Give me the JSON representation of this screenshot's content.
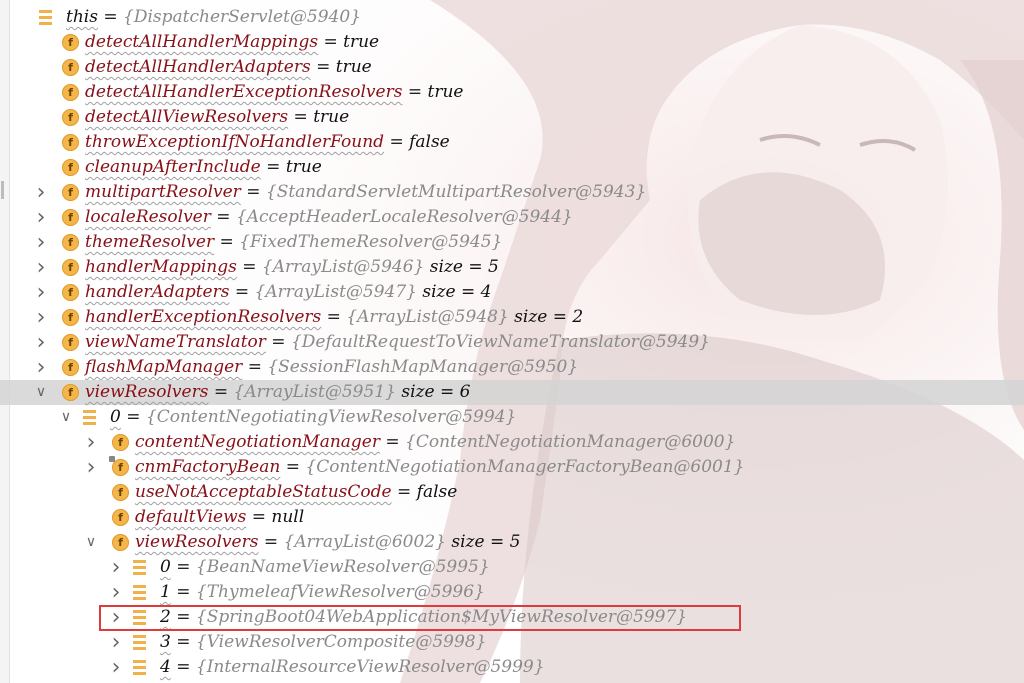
{
  "debugger": {
    "rows": [
      {
        "depth": 0,
        "icon": "list-icon",
        "chevron": "none",
        "name": "this",
        "eq": "=",
        "object": "{DispatcherServlet@5940}",
        "value": "",
        "size": "",
        "selected": false,
        "plain": true
      },
      {
        "depth": 1,
        "icon": "field-icon",
        "chevron": "none",
        "name": "detectAllHandlerMappings",
        "eq": "=",
        "object": "",
        "value": "true",
        "size": "",
        "selected": false
      },
      {
        "depth": 1,
        "icon": "field-icon",
        "chevron": "none",
        "name": "detectAllHandlerAdapters",
        "eq": "=",
        "object": "",
        "value": "true",
        "size": "",
        "selected": false
      },
      {
        "depth": 1,
        "icon": "field-icon",
        "chevron": "none",
        "name": "detectAllHandlerExceptionResolvers",
        "eq": "=",
        "object": "",
        "value": "true",
        "size": "",
        "selected": false
      },
      {
        "depth": 1,
        "icon": "field-icon",
        "chevron": "none",
        "name": "detectAllViewResolvers",
        "eq": "=",
        "object": "",
        "value": "true",
        "size": "",
        "selected": false
      },
      {
        "depth": 1,
        "icon": "field-icon",
        "chevron": "none",
        "name": "throwExceptionIfNoHandlerFound",
        "eq": "=",
        "object": "",
        "value": "false",
        "size": "",
        "selected": false
      },
      {
        "depth": 1,
        "icon": "field-icon",
        "chevron": "none",
        "name": "cleanupAfterInclude",
        "eq": "=",
        "object": "",
        "value": "true",
        "size": "",
        "selected": false
      },
      {
        "depth": 1,
        "icon": "field-icon",
        "chevron": "collapsed",
        "name": "multipartResolver",
        "eq": "=",
        "object": "{StandardServletMultipartResolver@5943}",
        "value": "",
        "size": "",
        "selected": false
      },
      {
        "depth": 1,
        "icon": "field-icon",
        "chevron": "collapsed",
        "name": "localeResolver",
        "eq": "=",
        "object": "{AcceptHeaderLocaleResolver@5944}",
        "value": "",
        "size": "",
        "selected": false
      },
      {
        "depth": 1,
        "icon": "field-icon",
        "chevron": "collapsed",
        "name": "themeResolver",
        "eq": "=",
        "object": "{FixedThemeResolver@5945}",
        "value": "",
        "size": "",
        "selected": false
      },
      {
        "depth": 1,
        "icon": "field-icon",
        "chevron": "collapsed",
        "name": "handlerMappings",
        "eq": "=",
        "object": "{ArrayList@5946}",
        "value": "",
        "size": "size = 5",
        "selected": false
      },
      {
        "depth": 1,
        "icon": "field-icon",
        "chevron": "collapsed",
        "name": "handlerAdapters",
        "eq": "=",
        "object": "{ArrayList@5947}",
        "value": "",
        "size": "size = 4",
        "selected": false
      },
      {
        "depth": 1,
        "icon": "field-icon",
        "chevron": "collapsed",
        "name": "handlerExceptionResolvers",
        "eq": "=",
        "object": "{ArrayList@5948}",
        "value": "",
        "size": "size = 2",
        "selected": false
      },
      {
        "depth": 1,
        "icon": "field-icon",
        "chevron": "collapsed",
        "name": "viewNameTranslator",
        "eq": "=",
        "object": "{DefaultRequestToViewNameTranslator@5949}",
        "value": "",
        "size": "",
        "selected": false
      },
      {
        "depth": 1,
        "icon": "field-icon",
        "chevron": "collapsed",
        "name": "flashMapManager",
        "eq": "=",
        "object": "{SessionFlashMapManager@5950}",
        "value": "",
        "size": "",
        "selected": false
      },
      {
        "depth": 1,
        "icon": "field-icon",
        "chevron": "expanded",
        "name": "viewResolvers",
        "eq": "=",
        "object": "{ArrayList@5951}",
        "value": "",
        "size": "size = 6",
        "selected": true
      },
      {
        "depth": 2,
        "icon": "list-icon",
        "chevron": "expanded",
        "name": "0",
        "eq": "=",
        "object": "{ContentNegotiatingViewResolver@5994}",
        "value": "",
        "size": "",
        "selected": false,
        "plain": true
      },
      {
        "depth": 3,
        "icon": "field-icon",
        "chevron": "collapsed",
        "name": "contentNegotiationManager",
        "eq": "=",
        "object": "{ContentNegotiationManager@6000}",
        "value": "",
        "size": "",
        "selected": false
      },
      {
        "depth": 3,
        "icon": "field-icon-locked",
        "chevron": "collapsed",
        "name": "cnmFactoryBean",
        "eq": "=",
        "object": "{ContentNegotiationManagerFactoryBean@6001}",
        "value": "",
        "size": "",
        "selected": false
      },
      {
        "depth": 3,
        "icon": "field-icon",
        "chevron": "none",
        "name": "useNotAcceptableStatusCode",
        "eq": "=",
        "object": "",
        "value": "false",
        "size": "",
        "selected": false
      },
      {
        "depth": 3,
        "icon": "field-icon",
        "chevron": "none",
        "name": "defaultViews",
        "eq": "=",
        "object": "",
        "value": "null",
        "size": "",
        "selected": false
      },
      {
        "depth": 3,
        "icon": "field-icon",
        "chevron": "expanded",
        "name": "viewResolvers",
        "eq": "=",
        "object": "{ArrayList@6002}",
        "value": "",
        "size": "size = 5",
        "selected": false
      },
      {
        "depth": 4,
        "icon": "list-icon",
        "chevron": "collapsed",
        "name": "0",
        "eq": "=",
        "object": "{BeanNameViewResolver@5995}",
        "value": "",
        "size": "",
        "selected": false,
        "plain": true
      },
      {
        "depth": 4,
        "icon": "list-icon",
        "chevron": "collapsed",
        "name": "1",
        "eq": "=",
        "object": "{ThymeleafViewResolver@5996}",
        "value": "",
        "size": "",
        "selected": false,
        "plain": true
      },
      {
        "depth": 4,
        "icon": "list-icon",
        "chevron": "collapsed",
        "name": "2",
        "eq": "=",
        "object": "{SpringBoot04WebApplication$MyViewResolver@5997}",
        "value": "",
        "size": "",
        "selected": false,
        "plain": true
      },
      {
        "depth": 4,
        "icon": "list-icon",
        "chevron": "collapsed",
        "name": "3",
        "eq": "=",
        "object": "{ViewResolverComposite@5998}",
        "value": "",
        "size": "",
        "selected": false,
        "plain": true
      },
      {
        "depth": 4,
        "icon": "list-icon",
        "chevron": "collapsed",
        "name": "4",
        "eq": "=",
        "object": "{InternalResourceViewResolver@5999}",
        "value": "",
        "size": "",
        "selected": false,
        "plain": true
      }
    ],
    "field_icon_letter": "f",
    "colors": {
      "field_name": "#871018",
      "object_ref": "#8a8a8a",
      "selection": "#d4d4d4",
      "highlight_box": "#e03b3b",
      "field_icon": "#f4b54a"
    }
  }
}
